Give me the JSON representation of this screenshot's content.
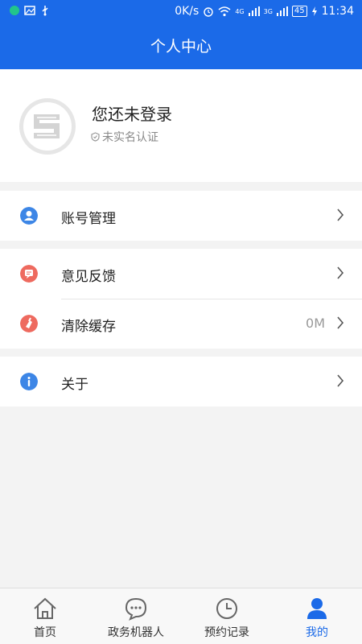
{
  "status_bar": {
    "speed": "0K/s",
    "network_4g": "4G",
    "network_3g": "3G",
    "battery": "45",
    "time": "11:34"
  },
  "header": {
    "title": "个人中心"
  },
  "profile": {
    "login_text": "您还未登录",
    "verify_text": "未实名认证"
  },
  "menu": {
    "account": {
      "label": "账号管理",
      "icon": "user-circle-icon",
      "color": "#3d86e6"
    },
    "feedback": {
      "label": "意见反馈",
      "icon": "message-icon",
      "color": "#ee6a5f"
    },
    "clear_cache": {
      "label": "清除缓存",
      "value": "0M",
      "icon": "broom-icon",
      "color": "#ee6a5f"
    },
    "about": {
      "label": "关于",
      "icon": "info-icon",
      "color": "#3d86e6"
    }
  },
  "tabs": [
    {
      "label": "首页",
      "icon": "home-icon"
    },
    {
      "label": "政务机器人",
      "icon": "chat-bubble-icon"
    },
    {
      "label": "预约记录",
      "icon": "clock-icon"
    },
    {
      "label": "我的",
      "icon": "person-icon"
    }
  ],
  "colors": {
    "primary": "#1b6ae8",
    "background": "#f3f3f3"
  }
}
